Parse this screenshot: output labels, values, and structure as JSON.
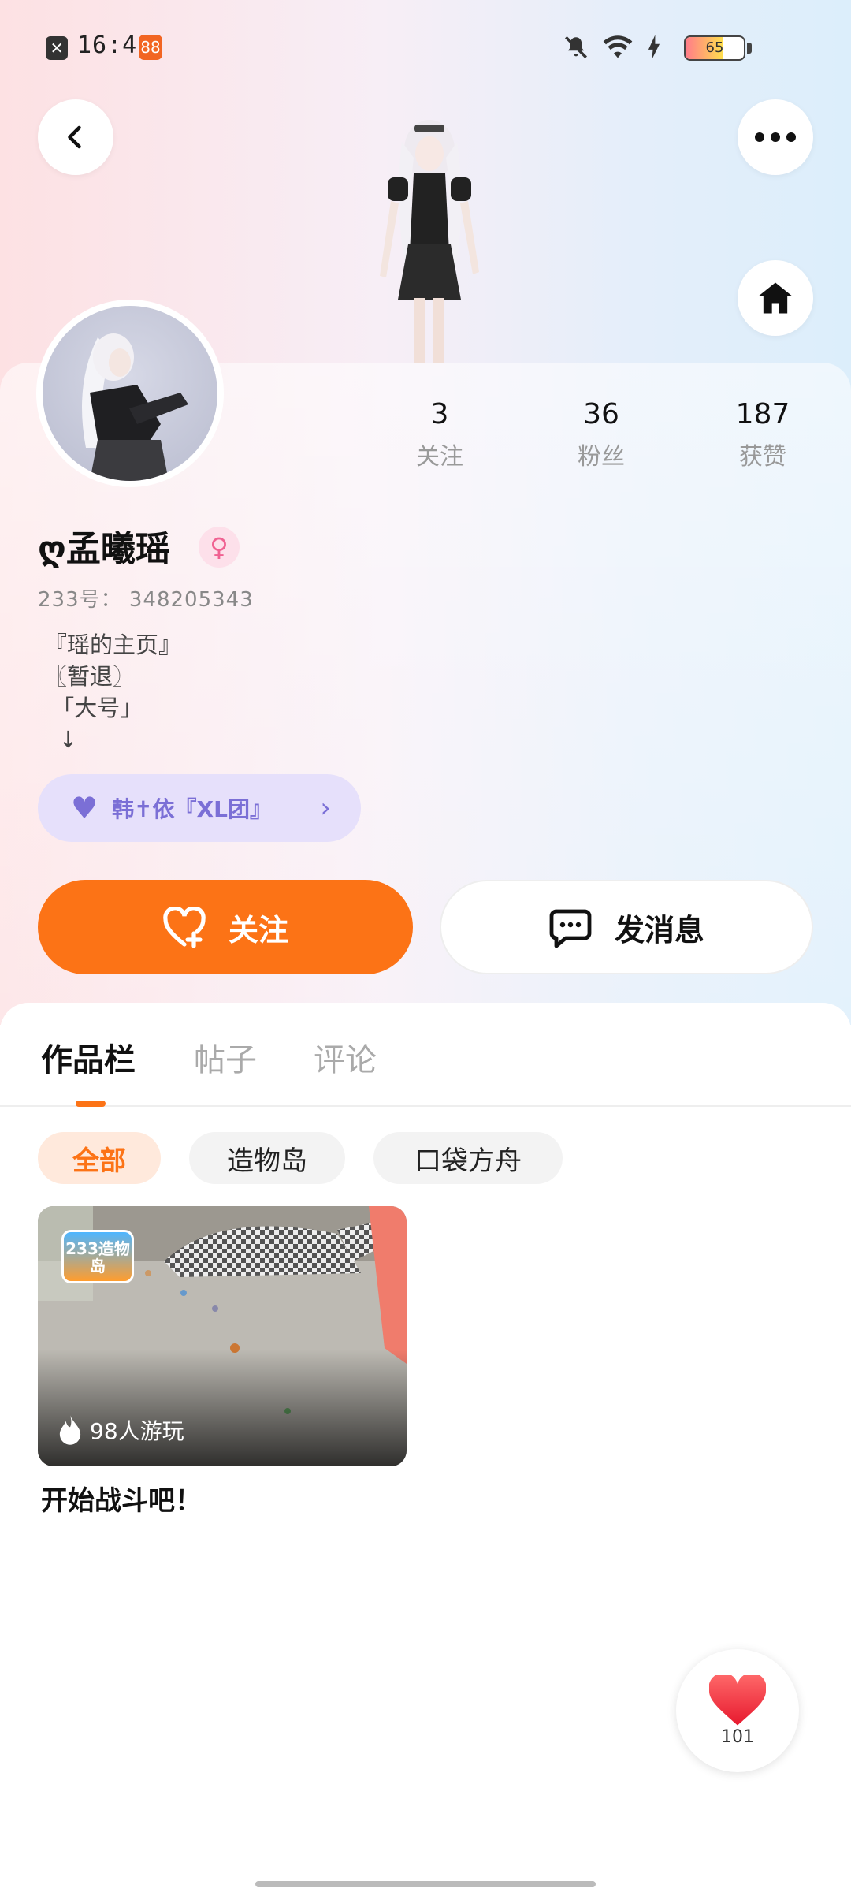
{
  "status_bar": {
    "time": "16:40",
    "battery": "65",
    "battery_level": 0.65,
    "icons": [
      "close-icon",
      "app-icon",
      "mute-icon",
      "wifi-icon",
      "charging-icon",
      "battery-icon"
    ]
  },
  "profile": {
    "name": "ღ孟曦瑶",
    "gender_symbol": "♀",
    "uid": "233号： 348205343",
    "bio_lines": [
      "『瑶的主页』",
      "〖暂退〗",
      " 「大号」",
      "  ↓"
    ],
    "stats": [
      {
        "value": "3",
        "label": "关注"
      },
      {
        "value": "36",
        "label": "粉丝"
      },
      {
        "value": "187",
        "label": "获赞"
      }
    ],
    "team": {
      "name": "韩✝依『XL团』"
    }
  },
  "actions": {
    "follow_label": "关注",
    "message_label": "发消息"
  },
  "tabs": [
    {
      "label": "作品栏",
      "active": true
    },
    {
      "label": "帖子",
      "active": false
    },
    {
      "label": "评论",
      "active": false
    }
  ],
  "filters": [
    {
      "label": "全部",
      "active": true
    },
    {
      "label": "造物岛",
      "active": false
    },
    {
      "label": "口袋方舟",
      "active": false
    }
  ],
  "works": [
    {
      "title": "开始战斗吧！",
      "plays": "98人游玩",
      "badge": "233造物岛"
    }
  ],
  "like_fab": {
    "count": "101"
  },
  "colors": {
    "accent": "#fc7316",
    "team_purple": "#7b6fd6",
    "gender_pink": "#f06292"
  }
}
